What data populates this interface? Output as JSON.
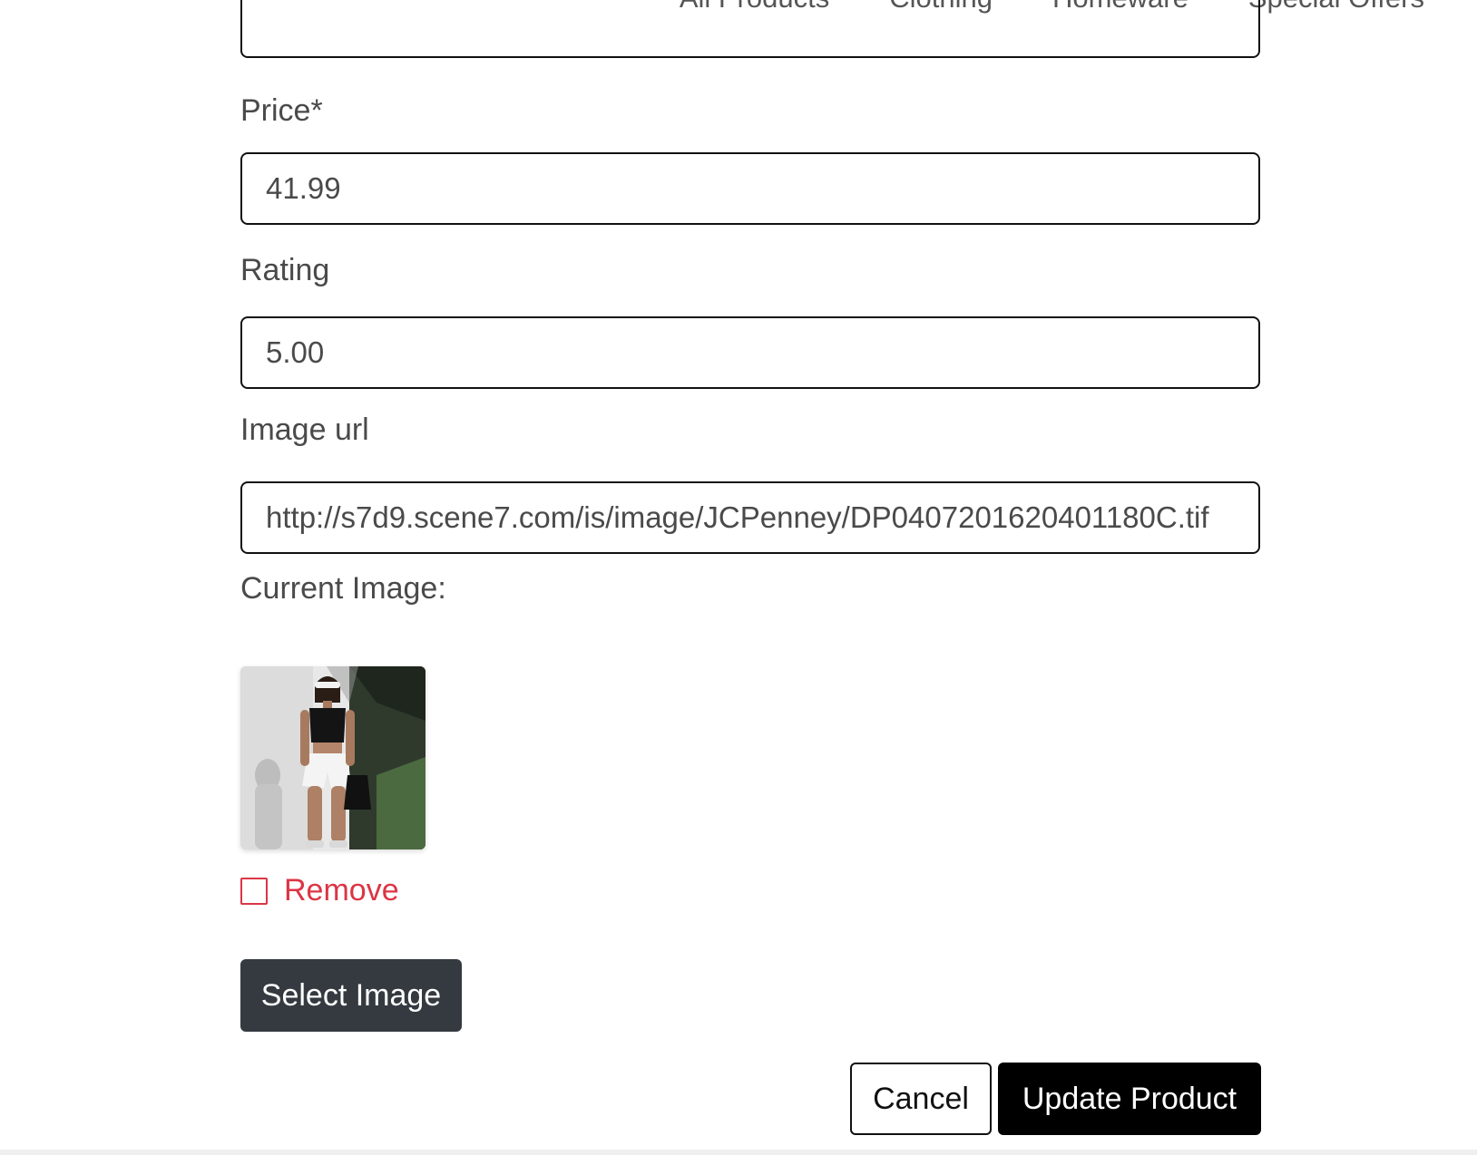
{
  "nav": {
    "items": [
      "All Products",
      "Clothing",
      "Homeware",
      "Special Offers"
    ]
  },
  "form": {
    "price": {
      "label": "Price*",
      "value": "41.99"
    },
    "rating": {
      "label": "Rating",
      "value": "5.00"
    },
    "image_url": {
      "label": "Image url",
      "value": "http://s7d9.scene7.com/is/image/JCPenney/DP0407201620401180C.tif"
    },
    "current_image": {
      "label": "Current Image:",
      "remove_label": "Remove"
    },
    "select_image_label": "Select Image",
    "cancel_label": "Cancel",
    "update_label": "Update Product"
  },
  "colors": {
    "danger": "#dc3545",
    "dark_button": "#343a40",
    "primary_button": "#000000"
  }
}
